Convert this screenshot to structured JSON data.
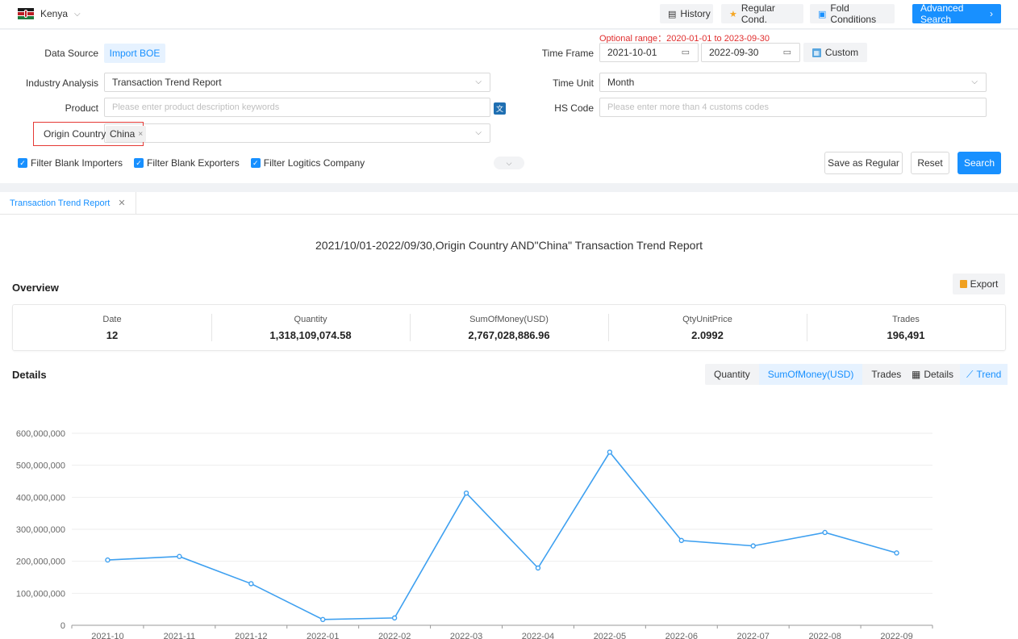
{
  "topbar": {
    "country": "Kenya",
    "history_label": "History",
    "regular_label": "Regular Cond.",
    "fold_label": "Fold Conditions",
    "advanced_label": "Advanced Search",
    "advanced_suffix": "›"
  },
  "filters": {
    "optional_range": "Optional range：2020-01-01 to 2023-09-30",
    "data_source_label": "Data Source",
    "data_source_value": "Import BOE",
    "time_frame_label": "Time Frame",
    "date_from": "2021-10-01",
    "date_to": "2022-09-30",
    "custom_label": "Custom",
    "industry_label": "Industry Analysis",
    "industry_value": "Transaction Trend Report",
    "time_unit_label": "Time Unit",
    "time_unit_value": "Month",
    "product_label": "Product",
    "product_placeholder": "Please enter product description keywords",
    "hs_label": "HS Code",
    "hs_placeholder": "Please enter more than 4 customs codes",
    "origin_label": "Origin Country",
    "origin_tag": "China",
    "checks": [
      "Filter Blank Importers",
      "Filter Blank Exporters",
      "Filter Logitics Company"
    ],
    "save_label": "Save as Regular",
    "reset_label": "Reset",
    "search_label": "Search"
  },
  "report": {
    "tab_label": "Transaction Trend Report",
    "title": "2021/10/01-2022/09/30,Origin Country AND\"China\" Transaction Trend Report",
    "overview_heading": "Overview",
    "export_label": "Export",
    "overview": [
      {
        "key": "Date",
        "value": "12"
      },
      {
        "key": "Quantity",
        "value": "1,318,109,074.58"
      },
      {
        "key": "SumOfMoney(USD)",
        "value": "2,767,028,886.96"
      },
      {
        "key": "QtyUnitPrice",
        "value": "2.0992"
      },
      {
        "key": "Trades",
        "value": "196,491"
      }
    ],
    "details_heading": "Details",
    "metric_tabs": [
      "Quantity",
      "SumOfMoney(USD)",
      "Trades"
    ],
    "active_metric": "SumOfMoney(USD)",
    "view_tabs": [
      "Details",
      "Trend"
    ],
    "active_view": "Trend"
  },
  "colors": {
    "accent": "#1890ff",
    "line": "#3ea0f0",
    "highlight_border": "#e53935",
    "range_text": "#e02d2d"
  },
  "chart_data": {
    "type": "line",
    "x": [
      "2021-10",
      "2021-11",
      "2021-12",
      "2022-01",
      "2022-02",
      "2022-03",
      "2022-04",
      "2022-05",
      "2022-06",
      "2022-07",
      "2022-08",
      "2022-09"
    ],
    "series": [
      {
        "values": [
          204000000,
          215000000,
          130000000,
          18000000,
          23000000,
          413000000,
          179000000,
          541000000,
          265000000,
          248000000,
          290000000,
          226000000
        ]
      }
    ],
    "y_ticks": [
      "600,000,000",
      "500,000,000",
      "400,000,000",
      "300,000,000",
      "200,000,000",
      "100,000,000",
      "0"
    ],
    "ylim": [
      0,
      600000000
    ],
    "grid": true
  }
}
